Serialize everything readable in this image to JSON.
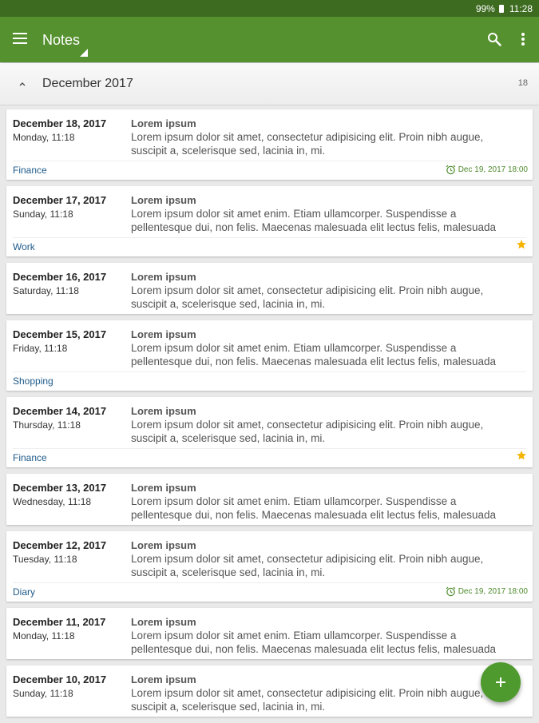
{
  "status_bar": {
    "battery": "99%",
    "time": "11:28"
  },
  "app_bar": {
    "title": "Notes"
  },
  "month_header": {
    "label": "December 2017",
    "count": "18"
  },
  "notes": [
    {
      "date": "December 18, 2017",
      "day": "Monday, 11:18",
      "title": "Lorem ipsum",
      "body": "Lorem ipsum dolor sit amet, consectetur adipisicing elit. Proin nibh augue, suscipit a, scelerisque sed, lacinia in, mi.",
      "category": "Finance",
      "reminder": "Dec 19, 2017 18:00",
      "starred": false
    },
    {
      "date": "December 17, 2017",
      "day": "Sunday, 11:18",
      "title": "Lorem ipsum",
      "body": "Lorem ipsum dolor sit amet enim. Etiam ullamcorper. Suspendisse a pellentesque dui, non felis. Maecenas malesuada elit lectus felis, malesuada",
      "category": "Work",
      "reminder": "",
      "starred": true
    },
    {
      "date": "December 16, 2017",
      "day": "Saturday, 11:18",
      "title": "Lorem ipsum",
      "body": "Lorem ipsum dolor sit amet, consectetur adipisicing elit. Proin nibh augue, suscipit a, scelerisque sed, lacinia in, mi.",
      "category": "",
      "reminder": "",
      "starred": false
    },
    {
      "date": "December 15, 2017",
      "day": "Friday, 11:18",
      "title": "Lorem ipsum",
      "body": "Lorem ipsum dolor sit amet enim. Etiam ullamcorper. Suspendisse a pellentesque dui, non felis. Maecenas malesuada elit lectus felis, malesuada",
      "category": "Shopping",
      "reminder": "",
      "starred": false
    },
    {
      "date": "December 14, 2017",
      "day": "Thursday, 11:18",
      "title": "Lorem ipsum",
      "body": "Lorem ipsum dolor sit amet, consectetur adipisicing elit. Proin nibh augue, suscipit a, scelerisque sed, lacinia in, mi.",
      "category": "Finance",
      "reminder": "",
      "starred": true
    },
    {
      "date": "December 13, 2017",
      "day": "Wednesday, 11:18",
      "title": "Lorem ipsum",
      "body": "Lorem ipsum dolor sit amet enim. Etiam ullamcorper. Suspendisse a pellentesque dui, non felis. Maecenas malesuada elit lectus felis, malesuada",
      "category": "",
      "reminder": "",
      "starred": false
    },
    {
      "date": "December 12, 2017",
      "day": "Tuesday, 11:18",
      "title": "Lorem ipsum",
      "body": "Lorem ipsum dolor sit amet, consectetur adipisicing elit. Proin nibh augue, suscipit a, scelerisque sed, lacinia in, mi.",
      "category": "Diary",
      "reminder": "Dec 19, 2017 18:00",
      "starred": false
    },
    {
      "date": "December 11, 2017",
      "day": "Monday, 11:18",
      "title": "Lorem ipsum",
      "body": "Lorem ipsum dolor sit amet enim. Etiam ullamcorper. Suspendisse a pellentesque dui, non felis. Maecenas malesuada elit lectus felis, malesuada",
      "category": "",
      "reminder": "",
      "starred": false
    },
    {
      "date": "December 10, 2017",
      "day": "Sunday, 11:18",
      "title": "Lorem ipsum",
      "body": "Lorem ipsum dolor sit amet, consectetur adipisicing elit. Proin nibh augue, suscipit a, scelerisque sed, lacinia in, mi.",
      "category": "",
      "reminder": "",
      "starred": false
    }
  ],
  "colors": {
    "app_bar": "#569130",
    "status_bar": "#3d6b20",
    "fab": "#4f9a2e",
    "star": "#f5b400",
    "category": "#1d5a8a",
    "reminder": "#4e8a2c"
  },
  "icons": {
    "menu": "menu-icon",
    "search": "search-icon",
    "more": "more-vert-icon",
    "collapse": "chevron-up-icon",
    "alarm": "alarm-icon",
    "star": "star-icon",
    "fab": "plus-icon"
  }
}
